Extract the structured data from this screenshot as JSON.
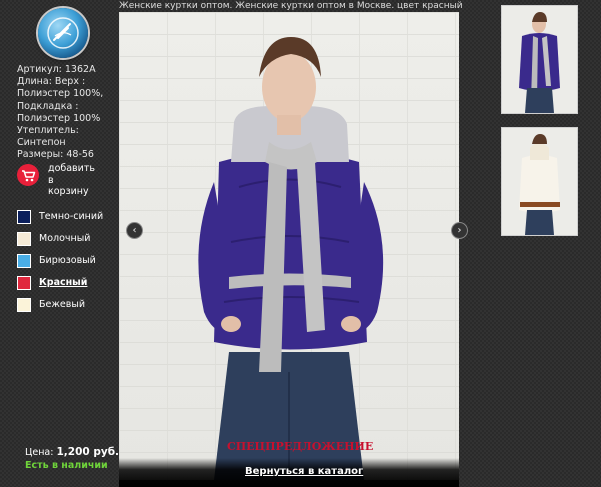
{
  "caption": "Женские куртки оптом. Женские куртки оптом в Москве. цвет красный",
  "specs": [
    "Артикул: 1362A",
    "Длина: Верх :",
    "Полиэстер 100%,",
    "Подкладка :",
    "Полиэстер 100%",
    "Утеплитель:",
    "Синтепон",
    "Размеры: 48-56"
  ],
  "cart": {
    "label_line1": "добавить",
    "label_line2": "в",
    "label_line3": "корзину",
    "icon": "cart-icon"
  },
  "colors": [
    {
      "label": "Темно-синий",
      "swatch": "#0b1f5c",
      "active": false
    },
    {
      "label": "Молочный",
      "swatch": "#f5ead6",
      "active": false
    },
    {
      "label": "Бирюзовый",
      "swatch": "#4aaee6",
      "active": false
    },
    {
      "label": "Красный",
      "swatch": "#e0283e",
      "active": true
    },
    {
      "label": "Бежевый",
      "swatch": "#fbf3d9",
      "active": false
    }
  ],
  "price": {
    "label": "Цена:",
    "value": "1,200 руб."
  },
  "stock": "Есть в наличии",
  "special_offer": "СПЕЦПРЕДЛОЖЕНИЕ",
  "back_link": "Вернуться в каталог",
  "nav": {
    "prev": "‹",
    "next": "›"
  },
  "accent": {
    "jacket": "#3a2a8c",
    "scarf": "#c4c4c4",
    "offer": "#c8102e",
    "stock": "#6fd43a"
  }
}
